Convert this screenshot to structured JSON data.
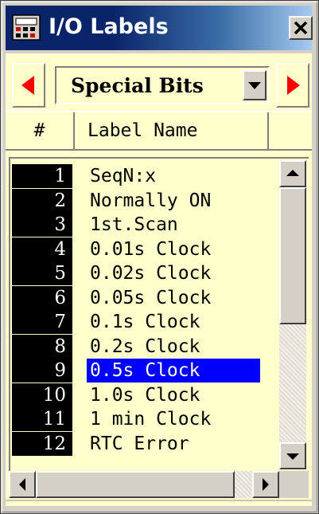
{
  "window": {
    "title": "I/O Labels",
    "app_icon": "calculator-app-icon",
    "close_icon": "close-x-icon"
  },
  "selector": {
    "value": "Special Bits",
    "prev_icon": "red-left-arrow-icon",
    "next_icon": "red-right-arrow-icon",
    "dropdown_icon": "chevron-down-icon"
  },
  "columns": {
    "number": "#",
    "label": "Label Name"
  },
  "rows": [
    {
      "num": "1",
      "label": "SeqN:x"
    },
    {
      "num": "2",
      "label": "Normally ON"
    },
    {
      "num": "3",
      "label": "1st.Scan"
    },
    {
      "num": "4",
      "label": "0.01s Clock"
    },
    {
      "num": "5",
      "label": "0.02s Clock"
    },
    {
      "num": "6",
      "label": "0.05s Clock"
    },
    {
      "num": "7",
      "label": "0.1s Clock"
    },
    {
      "num": "8",
      "label": "0.2s Clock"
    },
    {
      "num": "9",
      "label": "0.5s Clock"
    },
    {
      "num": "10",
      "label": "1.0s Clock"
    },
    {
      "num": "11",
      "label": "1 min Clock"
    },
    {
      "num": "12",
      "label": "RTC Error"
    }
  ],
  "selected_row": "9",
  "colors": {
    "title_bar": "#0a246a",
    "panel_background": "#ffffcc",
    "selection": "#0000ff",
    "nav_arrow": "#ff0000"
  },
  "vertical_scroll": {
    "position": 0.0,
    "visible_fraction": 0.5
  },
  "horizontal_scroll": {
    "position": 0.0,
    "visible_fraction": 0.8
  }
}
